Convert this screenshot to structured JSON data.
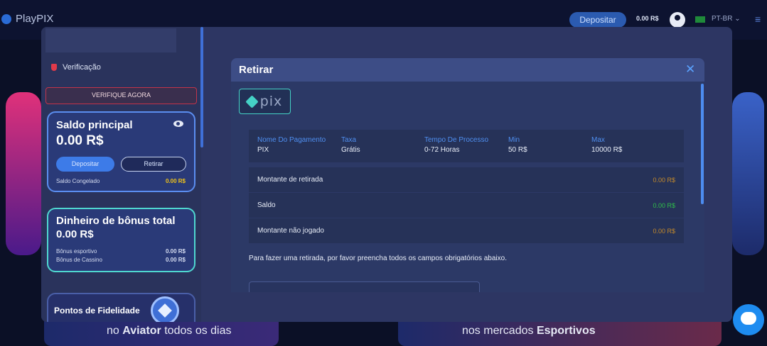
{
  "topbar": {
    "logo": "PlayPIX",
    "deposit_label": "Depositar",
    "balance": "0.00 R$",
    "language": "PT-BR"
  },
  "background": {
    "banner_left": {
      "highlight": "Aviator",
      "prefix": "no ",
      "suffix": " todos os dias"
    },
    "banner_right": {
      "prefix": "nos mercados ",
      "highlight": "Esportivos"
    }
  },
  "sidebar": {
    "verification_label": "Verificação",
    "verify_now_label": "VERIFIQUE AGORA",
    "main_balance": {
      "title": "Saldo principal",
      "amount": "0.00 R$",
      "deposit_label": "Depositar",
      "withdraw_label": "Retirar",
      "frozen_label": "Saldo Congelado",
      "frozen_value": "0.00 R$"
    },
    "bonus": {
      "title": "Dinheiro de bônus total",
      "amount": "0.00 R$",
      "sports_label": "Bônus esportivo",
      "sports_value": "0.00 R$",
      "casino_label": "Bônus de Cassino",
      "casino_value": "0.00 R$"
    },
    "loyalty": {
      "title": "Pontos de Fidelidade"
    }
  },
  "withdraw": {
    "title": "Retirar",
    "close_icon": "close-icon",
    "payment_logo_text": "pix",
    "info": {
      "headers": [
        "Nome Do Pagamento",
        "Taxa",
        "Tempo De Processo",
        "Min",
        "Max"
      ],
      "values": [
        "PIX",
        "Grátis",
        "0-72 Horas",
        "50 R$",
        "10000 R$"
      ]
    },
    "rows": [
      {
        "label": "Montante de retirada",
        "value": "0.00 R$"
      },
      {
        "label": "Saldo",
        "value": "0.00 R$"
      },
      {
        "label": "Montante não jogado",
        "value": "0.00 R$"
      }
    ],
    "note": "Para fazer uma retirada, por favor preencha todos os campos obrigatórios abaixo."
  },
  "colors": {
    "accent_blue": "#3d7be8",
    "verify_red": "#c2344a",
    "bonus_teal": "#4fd8d0",
    "frozen_yellow": "#f2c418",
    "amount_orange": "#c48a2a",
    "amount_green": "#2fbf4a"
  }
}
